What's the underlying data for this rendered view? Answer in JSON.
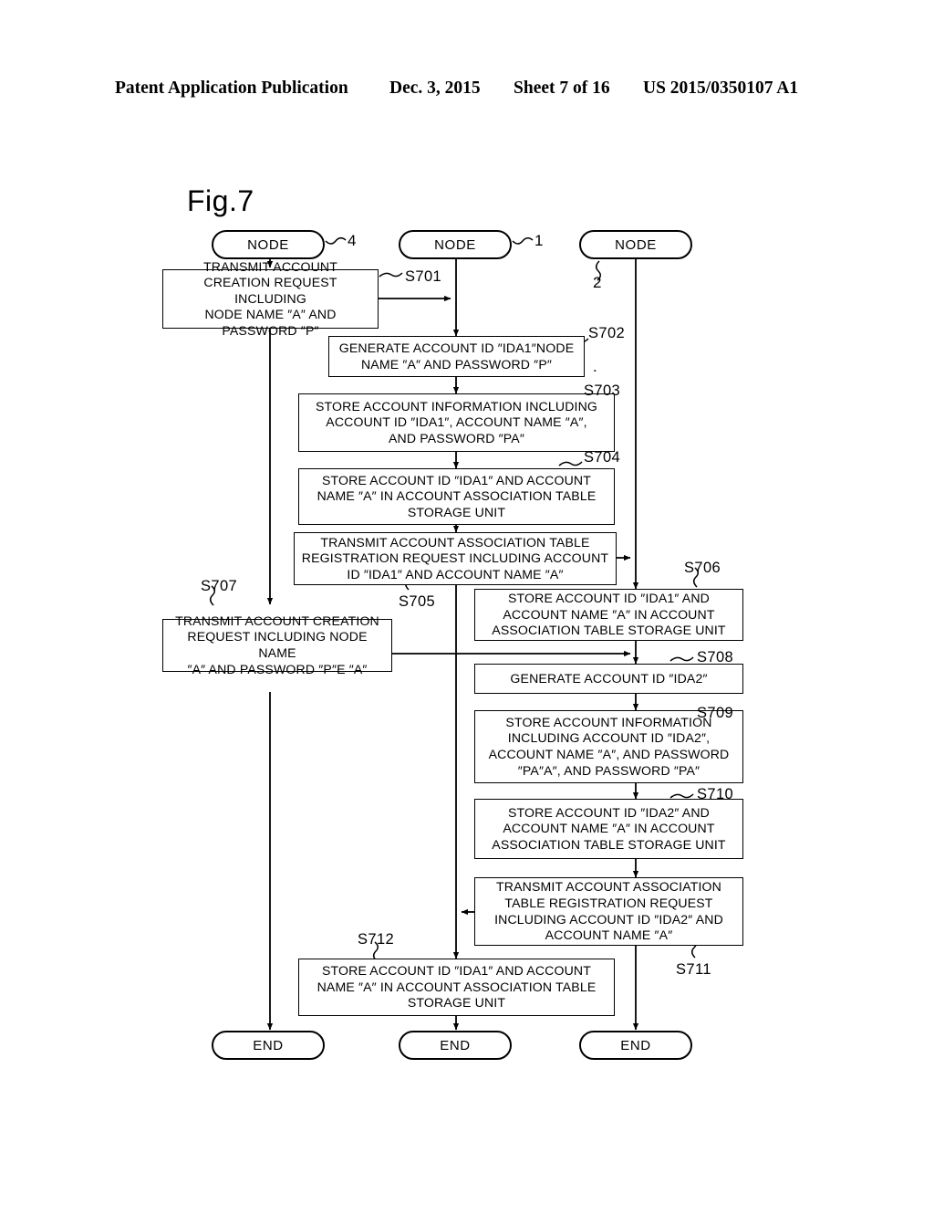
{
  "header": {
    "publication": "Patent Application Publication",
    "date": "Dec. 3, 2015",
    "sheet": "Sheet 7 of 16",
    "number": "US 2015/0350107 A1"
  },
  "figure": {
    "title": "Fig.7",
    "dot_mark": "."
  },
  "lanes": [
    {
      "id": "lane-left",
      "terminal_start": "NODE",
      "ref": "4",
      "terminal_end": "END"
    },
    {
      "id": "lane-middle",
      "terminal_start": "NODE",
      "ref": "1",
      "terminal_end": "END"
    },
    {
      "id": "lane-right",
      "terminal_start": "NODE",
      "ref": "2",
      "terminal_end": "END"
    }
  ],
  "steps": [
    {
      "id": "S701",
      "label": "S701",
      "lane": "left",
      "lines": [
        "TRANSMIT ACCOUNT",
        "CREATION REQUEST INCLUDING",
        "NODE NAME ″A″ AND",
        "PASSWORD ″P″"
      ]
    },
    {
      "id": "S702",
      "label": "S702",
      "lane": "middle",
      "lines": [
        "GENERATE ACCOUNT ID ″IDA1″NODE",
        "NAME ″A″ AND PASSWORD ″P″"
      ]
    },
    {
      "id": "S703",
      "label": "S703",
      "lane": "middle",
      "lines": [
        "STORE ACCOUNT INFORMATION INCLUDING",
        "ACCOUNT ID ″IDA1″, ACCOUNT NAME ″A″,",
        "AND PASSWORD ″PA″"
      ]
    },
    {
      "id": "S704",
      "label": "S704",
      "lane": "middle",
      "lines": [
        "STORE ACCOUNT ID ″IDA1″ AND ACCOUNT",
        "NAME ″A″ IN ACCOUNT ASSOCIATION TABLE",
        "STORAGE UNIT"
      ]
    },
    {
      "id": "S705",
      "label": "S705",
      "lane": "middle",
      "lines": [
        "TRANSMIT ACCOUNT ASSOCIATION TABLE",
        "REGISTRATION REQUEST INCLUDING ACCOUNT",
        "ID ″IDA1″ AND ACCOUNT NAME ″A″"
      ]
    },
    {
      "id": "S706",
      "label": "S706",
      "lane": "right",
      "lines": [
        "STORE ACCOUNT ID ″IDA1″ AND",
        "ACCOUNT NAME ″A″ IN ACCOUNT",
        "ASSOCIATION TABLE STORAGE UNIT"
      ]
    },
    {
      "id": "S707",
      "label": "S707",
      "lane": "left",
      "lines": [
        "TRANSMIT ACCOUNT CREATION",
        "REQUEST INCLUDING NODE NAME",
        "″A″ AND PASSWORD ″P″E ″A″"
      ]
    },
    {
      "id": "S708",
      "label": "S708",
      "lane": "right",
      "lines": [
        "GENERATE ACCOUNT ID ″IDA2″"
      ]
    },
    {
      "id": "S709",
      "label": "S709",
      "lane": "right",
      "lines": [
        "STORE ACCOUNT INFORMATION",
        "INCLUDING ACCOUNT ID ″IDA2″,",
        "ACCOUNT NAME ″A″, AND PASSWORD",
        "″PA″A″, AND PASSWORD ″PA″"
      ]
    },
    {
      "id": "S710",
      "label": "S710",
      "lane": "right",
      "lines": [
        "STORE ACCOUNT ID ″IDA2″ AND",
        "ACCOUNT NAME ″A″ IN ACCOUNT",
        "ASSOCIATION TABLE STORAGE UNIT"
      ]
    },
    {
      "id": "S711",
      "label": "S711",
      "lane": "right",
      "lines": [
        "TRANSMIT ACCOUNT ASSOCIATION",
        "TABLE REGISTRATION REQUEST",
        "INCLUDING ACCOUNT ID ″IDA2″ AND",
        "ACCOUNT NAME ″A″"
      ]
    },
    {
      "id": "S712",
      "label": "S712",
      "lane": "middle",
      "lines": [
        "STORE ACCOUNT ID ″IDA1″ AND ACCOUNT",
        "NAME ″A″ IN ACCOUNT ASSOCIATION TABLE",
        "STORAGE UNIT"
      ]
    }
  ]
}
